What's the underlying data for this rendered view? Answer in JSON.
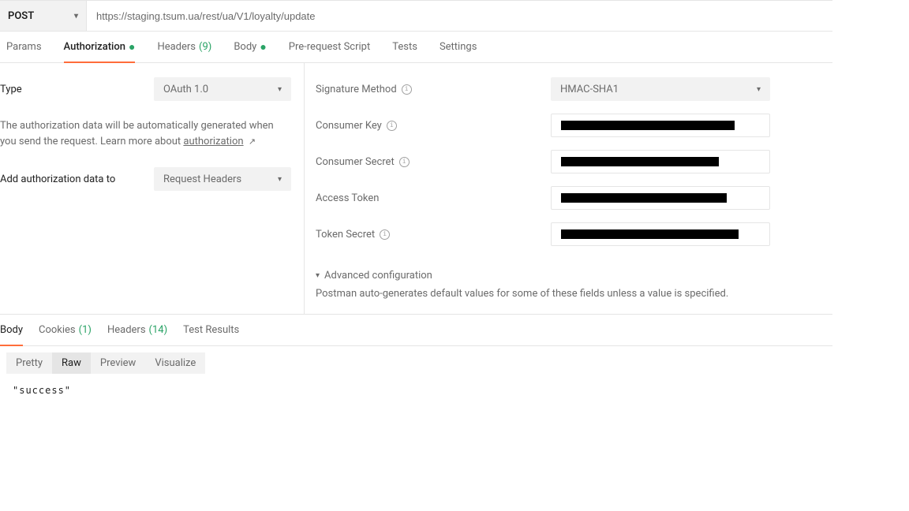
{
  "request": {
    "method": "POST",
    "url": "https://staging.tsum.ua/rest/ua/V1/loyalty/update"
  },
  "tabs": {
    "params": "Params",
    "auth": "Authorization",
    "headers": "Headers",
    "headers_count": "(9)",
    "body": "Body",
    "prescript": "Pre-request Script",
    "tests": "Tests",
    "settings": "Settings"
  },
  "auth": {
    "type_label": "Type",
    "type_value": "OAuth 1.0",
    "desc_prefix": "The authorization data will be automatically generated when you send the request. Learn more about ",
    "desc_link": "authorization",
    "add_label": "Add authorization data to",
    "add_value": "Request Headers",
    "sig_label": "Signature Method",
    "sig_value": "HMAC-SHA1",
    "ck_label": "Consumer Key",
    "cs_label": "Consumer Secret",
    "at_label": "Access Token",
    "ts_label": "Token Secret",
    "advanced": "Advanced configuration",
    "advanced_desc": "Postman auto-generates default values for some of these fields unless a value is specified."
  },
  "response_tabs": {
    "body": "Body",
    "cookies": "Cookies",
    "cookies_count": "(1)",
    "headers": "Headers",
    "headers_count": "(14)",
    "test": "Test Results"
  },
  "view_tabs": {
    "pretty": "Pretty",
    "raw": "Raw",
    "preview": "Preview",
    "visualize": "Visualize"
  },
  "response_body": "\"success\""
}
